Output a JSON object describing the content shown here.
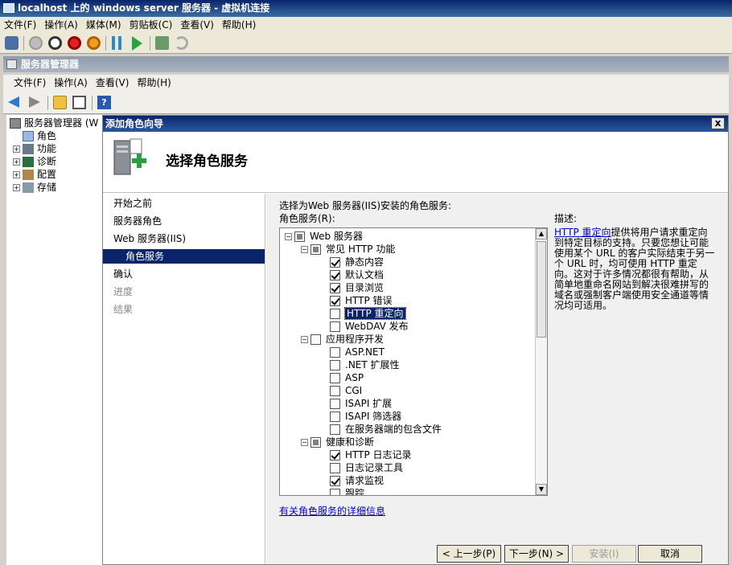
{
  "vm_window": {
    "title": "localhost 上的 windows server 服务器 - 虚拟机连接",
    "menu": [
      "文件(F)",
      "操作(A)",
      "媒体(M)",
      "剪贴板(C)",
      "查看(V)",
      "帮助(H)"
    ],
    "toolbar_icons": [
      "ctrl-alt-del-icon",
      "start-icon",
      "turnoff-icon",
      "shutdown-icon",
      "save-state-icon",
      "pause-icon",
      "resume-icon",
      "snapshot-icon",
      "revert-icon"
    ]
  },
  "server_manager": {
    "title": "服务器管理器",
    "menu": [
      "文件(F)",
      "操作(A)",
      "查看(V)",
      "帮助(H)"
    ],
    "tree": [
      {
        "label": "服务器管理器 (W",
        "level": 0,
        "expander": ""
      },
      {
        "label": "角色",
        "level": 1,
        "expander": ""
      },
      {
        "label": "功能",
        "level": 1,
        "expander": "+"
      },
      {
        "label": "诊断",
        "level": 1,
        "expander": "+"
      },
      {
        "label": "配置",
        "level": 1,
        "expander": "+"
      },
      {
        "label": "存储",
        "level": 1,
        "expander": "+"
      }
    ]
  },
  "wizard": {
    "title": "添加角色向导",
    "close_label": "x",
    "heading": "选择角色服务",
    "nav": [
      {
        "label": "开始之前",
        "state": "normal"
      },
      {
        "label": "服务器角色",
        "state": "normal"
      },
      {
        "label": "Web 服务器(IIS)",
        "state": "normal"
      },
      {
        "label": "角色服务",
        "state": "current"
      },
      {
        "label": "确认",
        "state": "normal"
      },
      {
        "label": "进度",
        "state": "disabled"
      },
      {
        "label": "结果",
        "state": "disabled"
      }
    ],
    "instruction": "选择为Web 服务器(IIS)安装的角色服务:",
    "list_label": "角色服务(R):",
    "role_services": [
      {
        "label": "Web 服务器",
        "level": 0,
        "expander": "−",
        "state": "partial"
      },
      {
        "label": "常见 HTTP 功能",
        "level": 1,
        "expander": "−",
        "state": "partial"
      },
      {
        "label": "静态内容",
        "level": 2,
        "state": "checked"
      },
      {
        "label": "默认文档",
        "level": 2,
        "state": "checked"
      },
      {
        "label": "目录浏览",
        "level": 2,
        "state": "checked"
      },
      {
        "label": "HTTP 错误",
        "level": 2,
        "state": "checked"
      },
      {
        "label": "HTTP 重定向",
        "level": 2,
        "state": "unchecked",
        "selected": true
      },
      {
        "label": "WebDAV 发布",
        "level": 2,
        "state": "unchecked"
      },
      {
        "label": "应用程序开发",
        "level": 1,
        "expander": "−",
        "state": "unchecked"
      },
      {
        "label": "ASP.NET",
        "level": 2,
        "state": "unchecked"
      },
      {
        "label": ".NET 扩展性",
        "level": 2,
        "state": "unchecked"
      },
      {
        "label": "ASP",
        "level": 2,
        "state": "unchecked"
      },
      {
        "label": "CGI",
        "level": 2,
        "state": "unchecked"
      },
      {
        "label": "ISAPI 扩展",
        "level": 2,
        "state": "unchecked"
      },
      {
        "label": "ISAPI 筛选器",
        "level": 2,
        "state": "unchecked"
      },
      {
        "label": "在服务器端的包含文件",
        "level": 2,
        "state": "unchecked"
      },
      {
        "label": "健康和诊断",
        "level": 1,
        "expander": "−",
        "state": "partial"
      },
      {
        "label": "HTTP 日志记录",
        "level": 2,
        "state": "checked"
      },
      {
        "label": "日志记录工具",
        "level": 2,
        "state": "unchecked"
      },
      {
        "label": "请求监视",
        "level": 2,
        "state": "checked"
      },
      {
        "label": "跟踪",
        "level": 2,
        "state": "unchecked"
      }
    ],
    "description_label": "描述:",
    "description_link": "HTTP 重定向",
    "description_text": "提供将用户请求重定向到特定目标的支持。只要您想让可能使用某个 URL 的客户实际结束于另一个 URL 时，均可使用 HTTP 重定向。这对于许多情况都很有帮助，从简单地重命名网站到解决很难拼写的域名或强制客户端使用安全通道等情况均可适用。",
    "more_info_link": "有关角色服务的详细信息",
    "buttons": {
      "back": "< 上一步(P)",
      "next": "下一步(N) >",
      "install": "安装(I)",
      "cancel": "取消"
    }
  }
}
